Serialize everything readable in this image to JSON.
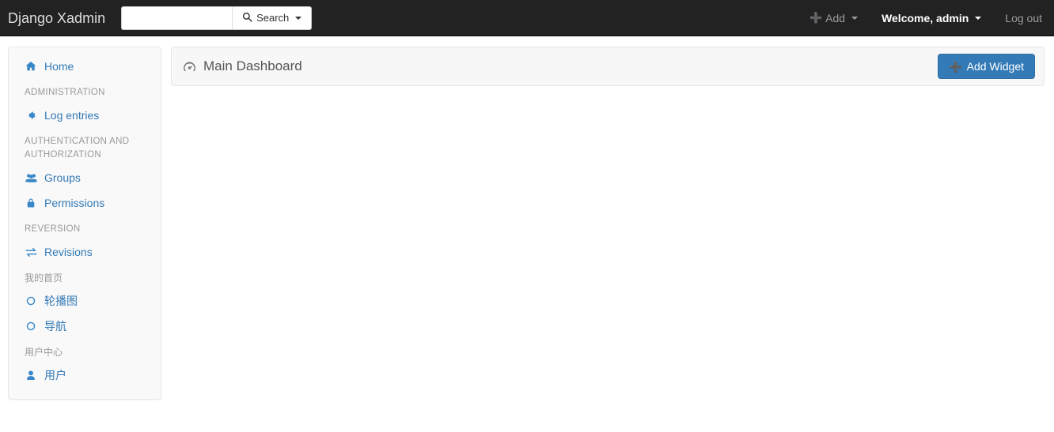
{
  "navbar": {
    "brand": "Django Xadmin",
    "search": {
      "value": "",
      "placeholder": "",
      "button_label": "Search",
      "icon": "search-icon"
    },
    "right_links": [
      {
        "label": "Add",
        "icon": "plus-icon",
        "caret": true,
        "strong": false
      },
      {
        "label": "Welcome, admin",
        "icon": "",
        "caret": true,
        "strong": true
      },
      {
        "label": "Log out",
        "icon": "",
        "caret": false,
        "strong": false
      }
    ]
  },
  "sidebar": {
    "home": {
      "label": "Home",
      "icon": "home-icon"
    },
    "groups": [
      {
        "header": "ADMINISTRATION",
        "cjk": false,
        "items": [
          {
            "label": "Log entries",
            "icon": "gear-icon"
          }
        ]
      },
      {
        "header": "AUTHENTICATION AND AUTHORIZATION",
        "cjk": false,
        "items": [
          {
            "label": "Groups",
            "icon": "users-icon"
          },
          {
            "label": "Permissions",
            "icon": "lock-icon"
          }
        ]
      },
      {
        "header": "REVERSION",
        "cjk": false,
        "items": [
          {
            "label": "Revisions",
            "icon": "exchange-icon"
          }
        ]
      },
      {
        "header": "我的首页",
        "cjk": true,
        "items": [
          {
            "label": "轮播图",
            "icon": "circle-o-icon"
          },
          {
            "label": "导航",
            "icon": "circle-o-icon"
          }
        ]
      },
      {
        "header": "用户中心",
        "cjk": true,
        "items": [
          {
            "label": "用户",
            "icon": "user-icon"
          }
        ]
      }
    ]
  },
  "main": {
    "title": "Main Dashboard",
    "title_icon": "dashboard-icon",
    "add_widget_label": "Add Widget"
  },
  "colors": {
    "navbar_bg": "#222222",
    "link_blue": "#337ab7",
    "primary_button": "#337ab7",
    "panel_bg": "#f7f7f7",
    "sidebar_bg": "#f9f9f9",
    "muted_text": "#999999",
    "nav_link": "#9d9d9d"
  }
}
